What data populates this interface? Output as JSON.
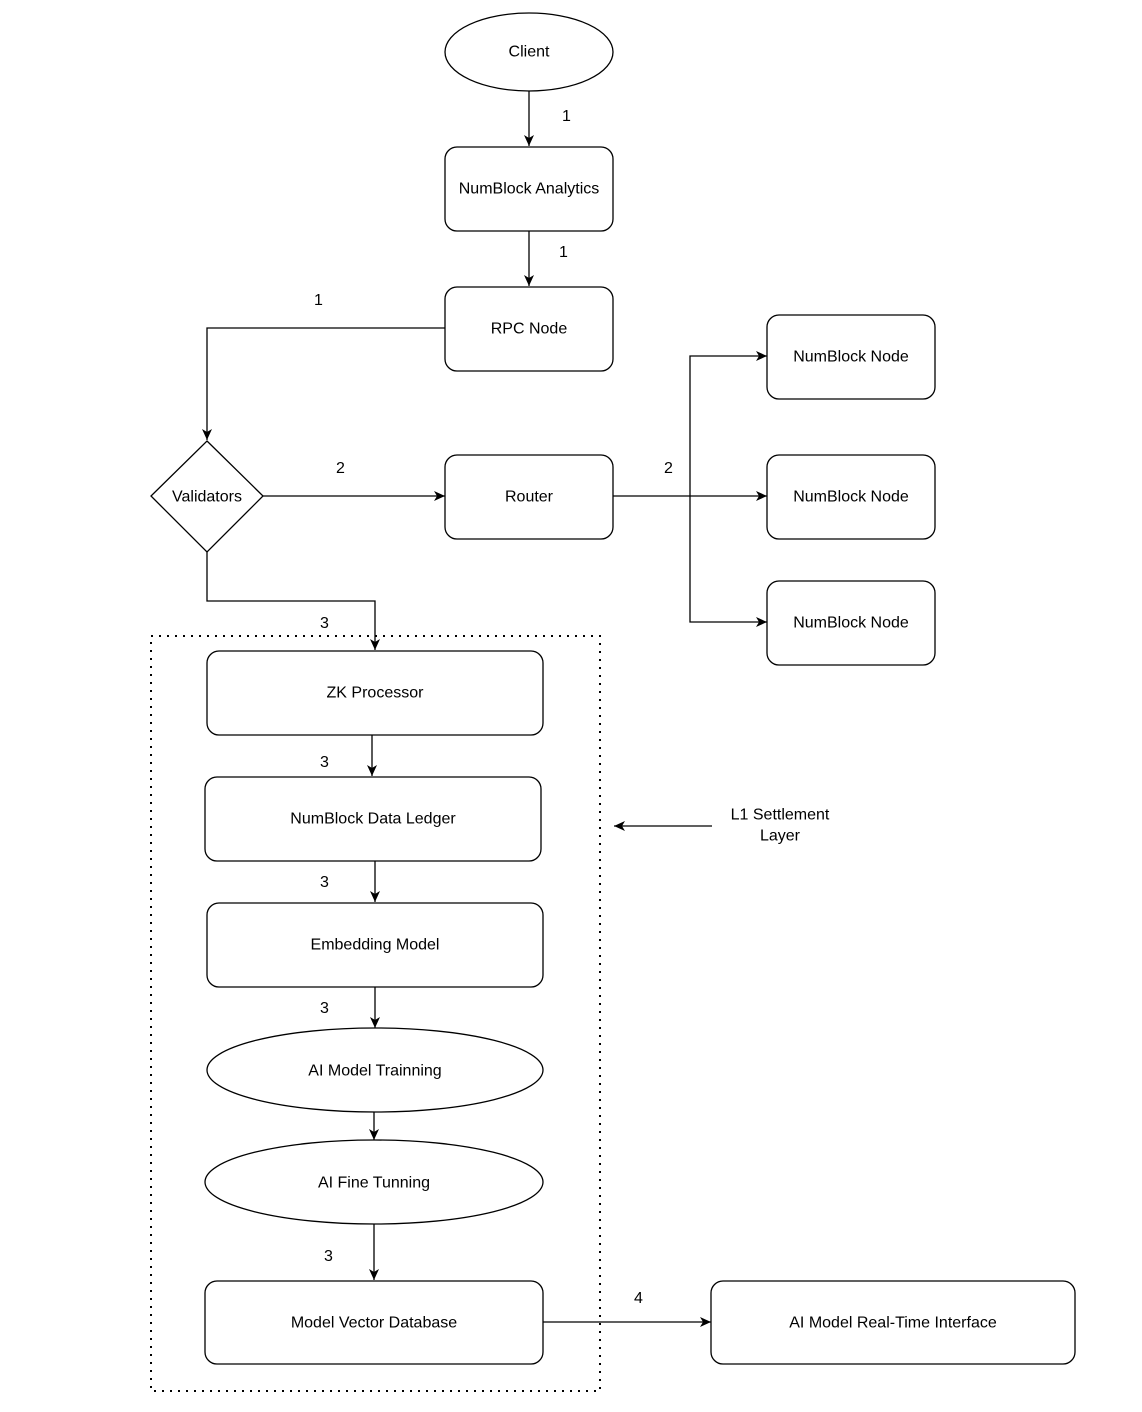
{
  "diagram": {
    "nodes": {
      "client": "Client",
      "analytics": "NumBlock Analytics",
      "rpc": "RPC Node",
      "validators": "Validators",
      "router": "Router",
      "numblock_node_1": "NumBlock Node",
      "numblock_node_2": "NumBlock Node",
      "numblock_node_3": "NumBlock Node",
      "zk_processor": "ZK Processor",
      "data_ledger": "NumBlock Data Ledger",
      "embedding_model": "Embedding Model",
      "ai_training": "AI Model Trainning",
      "ai_fine_tuning": "AI Fine Tunning",
      "vector_db": "Model Vector Database",
      "realtime_interface": "AI Model Real-Time Interface"
    },
    "edge_labels": {
      "client_to_analytics": "1",
      "analytics_to_rpc": "1",
      "rpc_to_validators": "1",
      "validators_to_router": "2",
      "router_to_nodes": "2",
      "validators_to_zk": "3",
      "zk_to_ledger": "3",
      "ledger_to_embedding": "3",
      "embedding_to_training": "3",
      "finetuning_to_vectordb": "3",
      "vectordb_to_interface": "4"
    },
    "annotation": {
      "line1": "L1 Settlement",
      "line2": "Layer"
    }
  }
}
